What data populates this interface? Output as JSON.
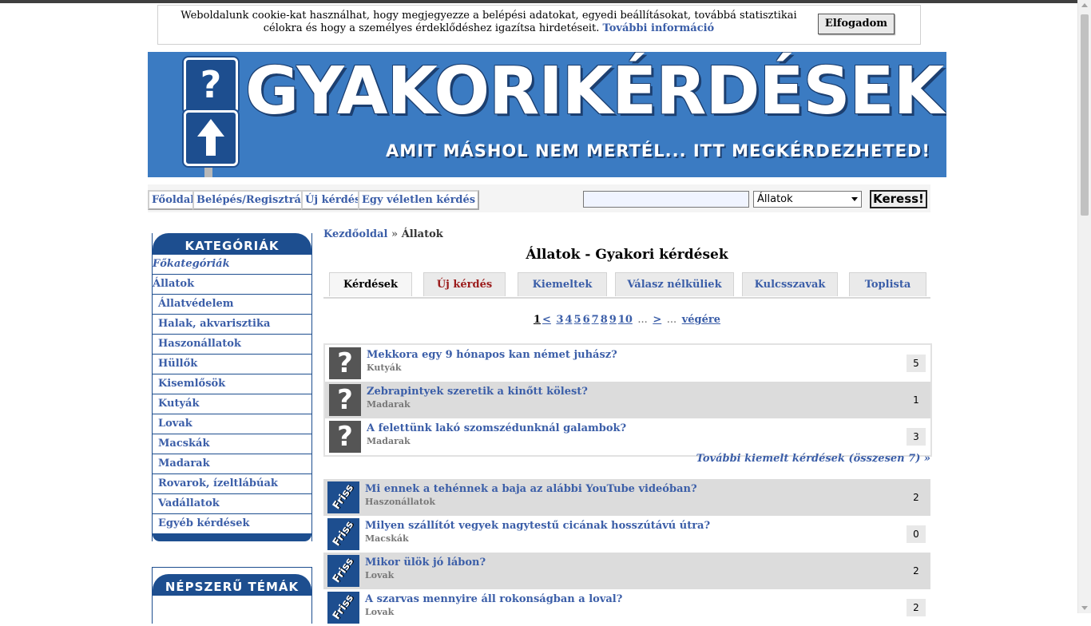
{
  "cookie": {
    "text": "Weboldalunk cookie-kat használhat, hogy megjegyezze a belépési adatokat, egyedi beállításokat, továbbá statisztikai célokra és hogy a személyes érdeklődéshez igazítsa hirdetéseit.",
    "more_link": "További információ",
    "accept_label": "Elfogadom"
  },
  "banner": {
    "brand": "GYAKORIKÉRDÉSEK.HU",
    "slogan": "AMIT MÁSHOL NEM MERTÉL... ITT MEGKÉRDEZHETED!",
    "sign_question": "?",
    "sign_arrow": "up-arrow-icon"
  },
  "nav": {
    "items": [
      "Főoldal",
      "Belépés/Regisztráció",
      "Új kérdés",
      "Egy véletlen kérdés"
    ],
    "search_value": "",
    "select_value": "Állatok",
    "search_button": "Keress!"
  },
  "sidebar": {
    "categories_title": "KATEGÓRIÁK",
    "main_link": "Főkategóriák",
    "current": "Állatok",
    "items": [
      "Állatvédelem",
      "Halak, akvarisztika",
      "Haszonállatok",
      "Hüllők",
      "Kisemlősök",
      "Kutyák",
      "Lovak",
      "Macskák",
      "Madarak",
      "Rovarok, ízeltlábúak",
      "Vadállatok",
      "Egyéb kérdések"
    ],
    "popular_title": "NÉPSZERŰ TÉMÁK"
  },
  "breadcrumb": {
    "home": "Kezdőoldal",
    "sep": "»",
    "current": "Állatok"
  },
  "page_title": "Állatok - Gyakori kérdések",
  "tabs": [
    "Kérdések",
    "Új kérdés",
    "Kiemeltek",
    "Válasz nélküliek",
    "Kulcsszavak",
    "Toplista"
  ],
  "pager": {
    "current": "1",
    "prev": "<",
    "pages": [
      "3",
      "4",
      "5",
      "6",
      "7",
      "8",
      "9",
      "10"
    ],
    "dots": "...",
    "next": ">",
    "dots2": "...",
    "end": "végére"
  },
  "featured": [
    {
      "title": "Mekkora egy 9 hónapos kan német juhász?",
      "category": "Kutyák",
      "count": "5"
    },
    {
      "title": "Zebrapintyek szeretik a kinőtt kölest?",
      "category": "Madarak",
      "count": "1"
    },
    {
      "title": "A felettünk lakó szomszédunknál galambok?",
      "category": "Madarak",
      "count": "3"
    }
  ],
  "more_featured": "További kiemelt kérdések (összesen 7) »",
  "fresh_label": "Friss",
  "fresh": [
    {
      "title": "Mi ennek a tehénnek a baja az alábbi YouTube videóban?",
      "category": "Haszonállatok",
      "count": "2"
    },
    {
      "title": "Milyen szállítót vegyek nagytestű cicának hosszútávú útra?",
      "category": "Macskák",
      "count": "0"
    },
    {
      "title": "Mikor ülök jó lábon?",
      "category": "Lovak",
      "count": "2"
    },
    {
      "title": "A szarvas mennyire áll rokonságban a loval?",
      "category": "Lovak",
      "count": "2"
    }
  ],
  "colors": {
    "brand_blue": "#3b7bc2",
    "dark_blue": "#1d4e8f",
    "link": "#3b5ea8",
    "new_question_red": "#9b1b1b"
  }
}
